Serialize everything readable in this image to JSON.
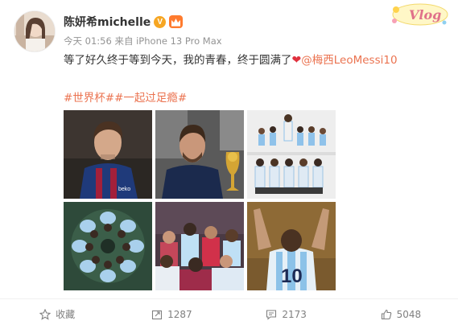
{
  "post": {
    "username": "陈妍希michelle",
    "verified_badge": "V",
    "timestamp": "今天 01:56",
    "source": "来自 iPhone 13 Pro Max",
    "text_main": "等了好久终于等到今天，我的青春，终于圆满了",
    "heart": "❤",
    "mention": "@梅西LeoMessi10",
    "hashtags": "#世界杯##一起过足瘾#",
    "sticker_text": "Vlog"
  },
  "images": [
    {
      "name": "photo-messi-barcelona-portrait"
    },
    {
      "name": "photo-messi-argentina-trophy"
    },
    {
      "name": "photo-argentina-team-cartoon"
    },
    {
      "name": "photo-argentina-team-huddle"
    },
    {
      "name": "photo-argentina-celebration-crowd"
    },
    {
      "name": "photo-messi-arms-raised-back"
    }
  ],
  "actions": {
    "favorite_label": "收藏",
    "repost_count": "1287",
    "comment_count": "2173",
    "like_count": "5048"
  },
  "colors": {
    "accent": "#eb7350",
    "muted": "#939393",
    "heart": "#e0313e",
    "verified": "#f6a623"
  }
}
